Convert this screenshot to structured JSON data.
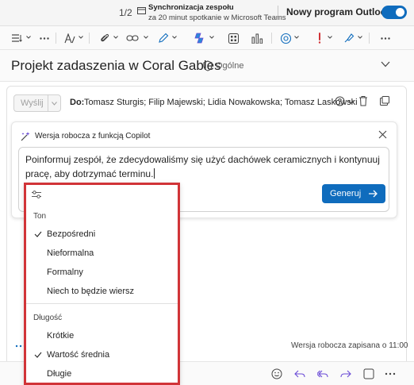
{
  "topbar": {
    "counter": "1/2",
    "sync_title": "Synchronizacja zespołu",
    "sync_subtitle": "za 20 minut spotkanie w Microsoft Teams",
    "new_outlook_label": "Nowy program Outlook",
    "toggle_on": true
  },
  "toolbar": {
    "icons": [
      "list-format-icon",
      "more-icon",
      "text-style-icon",
      "attach-icon",
      "link-icon",
      "pen-icon",
      "copilot-icon",
      "apps-icon",
      "chart-icon",
      "loop-icon",
      "important-icon",
      "paint-icon",
      "more-icon"
    ]
  },
  "subject": {
    "title": "Projekt zadaszenia w Coral Gables",
    "sensitivity": "Ogólne"
  },
  "compose": {
    "send_label": "Wyślij",
    "to_label": "Do:",
    "recipients": "Tomasz Sturgis; Filip Majewski; Lidia Nowakowska; Tomasz Laskowski",
    "draft_status": "Wersja robocza zapisana o 11:00"
  },
  "copilot": {
    "title": "Wersja robocza z funkcją Copilot",
    "prompt": "Poinformuj zespół, że zdecydowaliśmy się użyć dachówek ceramicznych i kontynuuj pracę, aby dotrzymać terminu.",
    "generate_label": "Generuj"
  },
  "options_menu": {
    "tone_heading": "Ton",
    "tone_items": [
      {
        "label": "Bezpośredni",
        "checked": true
      },
      {
        "label": "Nieformalna",
        "checked": false
      },
      {
        "label": "Formalny",
        "checked": false
      },
      {
        "label": "Niech to będzie wiersz",
        "checked": false
      }
    ],
    "length_heading": "Długość",
    "length_items": [
      {
        "label": "Krótkie",
        "checked": false
      },
      {
        "label": "Wartość średnia",
        "checked": true
      },
      {
        "label": "Długie",
        "checked": false
      }
    ]
  },
  "colors": {
    "accent": "#0f6cbd",
    "highlight_border": "#d13438",
    "copilot_icon": "#6a4bd6",
    "important_icon": "#d13438"
  }
}
